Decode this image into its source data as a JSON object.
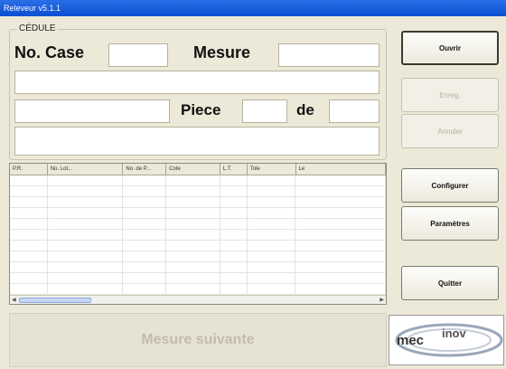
{
  "window": {
    "title": "Releveur v5.1.1"
  },
  "form": {
    "group_label": "CÉDULE",
    "case_label": "No. Case",
    "case_value": "",
    "mesure_label": "Mesure",
    "mesure_value": "",
    "line1_value": "",
    "line2_value": "",
    "piece_label": "Piece",
    "piece_value": "",
    "de_label": "de",
    "de_value": "",
    "line3_value": ""
  },
  "grid": {
    "columns": [
      "P.R.",
      "No. Lot...",
      "No. de P...",
      "Cote",
      "L.T.",
      "Tole",
      "Le"
    ],
    "rows": 11
  },
  "buttons": {
    "ouvrir": "Ouvrir",
    "enreg": "Enreg.",
    "annuler": "Annuler",
    "configurer": "Configurer",
    "parametres": "Paramètres",
    "quitter": "Quitter",
    "mesure_suivante": "Mesure suivante"
  },
  "logo": {
    "text_left": "mec",
    "text_right": "inov"
  },
  "colors": {
    "titlebar": "#0a4fd1",
    "background": "#ece9d8"
  }
}
